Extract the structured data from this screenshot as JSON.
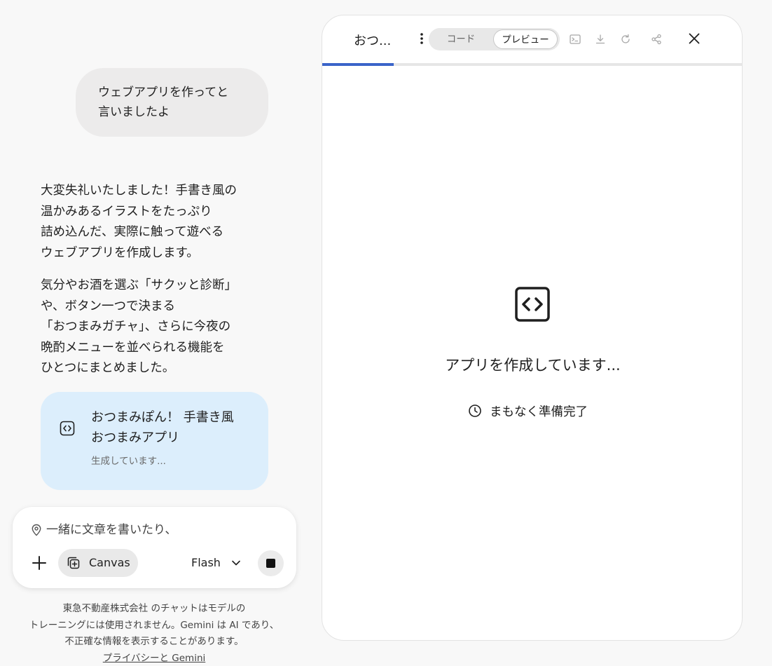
{
  "chat": {
    "user_message_lines": [
      "ウェブアプリを作ってと",
      "言いましたよ"
    ],
    "reply_paragraph_1_lines": [
      "大変失礼いたしました！手書き風の",
      "温かみあるイラストをたっぷり",
      "詰め込んだ、実際に触って遊べる",
      "ウェブアプリを作成します。"
    ],
    "reply_paragraph_2_lines": [
      "気分やお酒を選ぶ「サクッと診断」",
      "や、ボタン一つで決まる",
      "「おつまみガチャ」、さらに今夜の",
      "晩酌メニューを並べられる機能を",
      "ひとつにまとめました。"
    ],
    "canvas_card": {
      "icon": "code-icon",
      "title_lines": [
        "おつまみぽん！ 手書き風",
        "おつまみアプリ"
      ],
      "status": "生成しています..."
    }
  },
  "composer": {
    "placeholder": "一緒に文章を書いたり、",
    "location_icon": "location-pin-icon",
    "plus_icon": "plus-icon",
    "canvas_chip_label": "Canvas",
    "model_label": "Flash",
    "stop_icon": "stop-icon"
  },
  "disclaimer": {
    "lines": [
      "東急不動産株式会社 のチャットはモデルの",
      "トレーニングには使用されません。Gemini は AI であり、",
      "不正確な情報を表示することがあります。"
    ],
    "link_label": "プライバシーと Gemini"
  },
  "panel": {
    "title": "おつ...",
    "tabs": {
      "code": "コード",
      "preview": "プレビュー",
      "active": "preview"
    },
    "tools": [
      "terminal-icon",
      "download-icon",
      "refresh-icon",
      "share-icon"
    ],
    "progress": 0.17,
    "accent_color": "#3a64c9",
    "status_text": "アプリを作成しています...",
    "substatus_text": "まもなく準備完了"
  }
}
